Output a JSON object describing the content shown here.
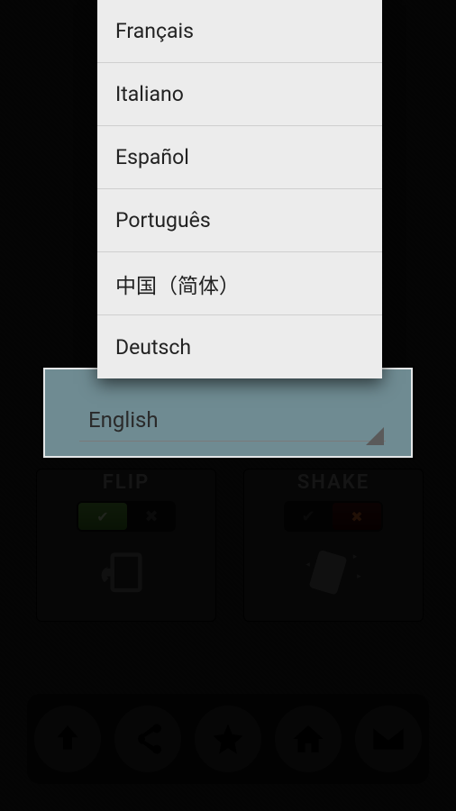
{
  "languages": {
    "options": [
      "Français",
      "Italiano",
      "Español",
      "Português",
      "中国（简体）",
      "Deutsch"
    ],
    "selected": "English"
  },
  "cards": {
    "flip": {
      "title": "FLIP",
      "toggle_on": true
    },
    "shake": {
      "title": "SHAKE",
      "toggle_on": false
    }
  },
  "bottom_icons": [
    "upload",
    "share",
    "star",
    "home",
    "mail"
  ]
}
